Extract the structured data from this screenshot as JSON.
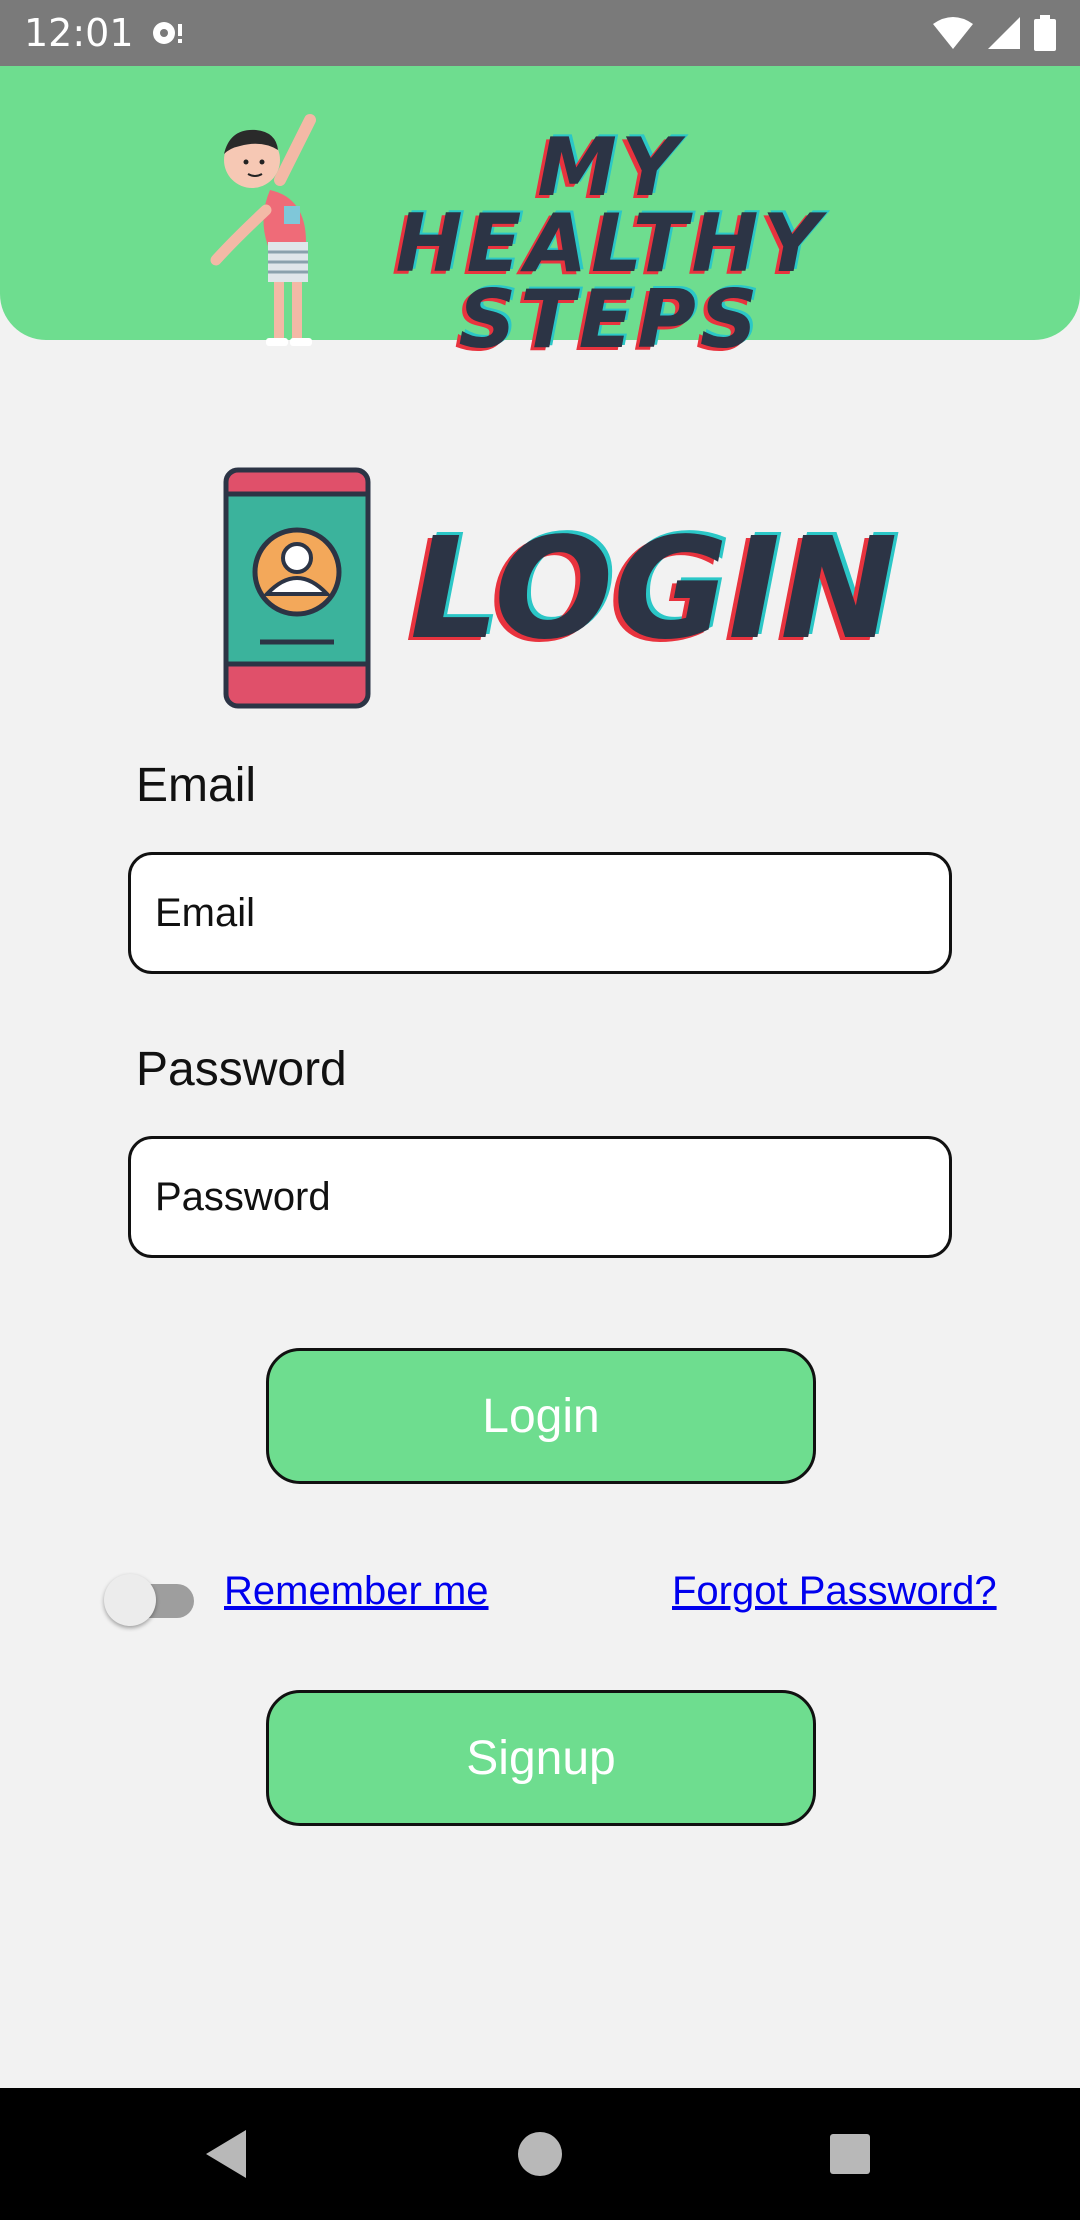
{
  "status_bar": {
    "time": "12:01",
    "icons": [
      "notification-icon",
      "wifi-icon",
      "signal-icon",
      "battery-icon"
    ]
  },
  "header": {
    "brand_line1": "MY HEALTHY",
    "brand_line2": "STEPS",
    "mascot_icon": "stretching-kid-illustration",
    "color": "#6edd8f"
  },
  "login_heading": {
    "title": "LOGIN",
    "icon": "phone-user-icon"
  },
  "form": {
    "email": {
      "label": "Email",
      "placeholder": "Email",
      "value": ""
    },
    "password": {
      "label": "Password",
      "placeholder": "Password",
      "value": ""
    },
    "login_button": "Login",
    "remember_me": {
      "label": "Remember me",
      "checked": false
    },
    "forgot_password": "Forgot Password?",
    "signup_button": "Signup"
  },
  "nav_bar": {
    "buttons": [
      "back-icon",
      "home-icon",
      "recents-icon"
    ]
  },
  "colors": {
    "accent": "#6edd8f",
    "background": "#f2f2f2",
    "link": "#0000ee",
    "title_dark": "#2c3445"
  }
}
